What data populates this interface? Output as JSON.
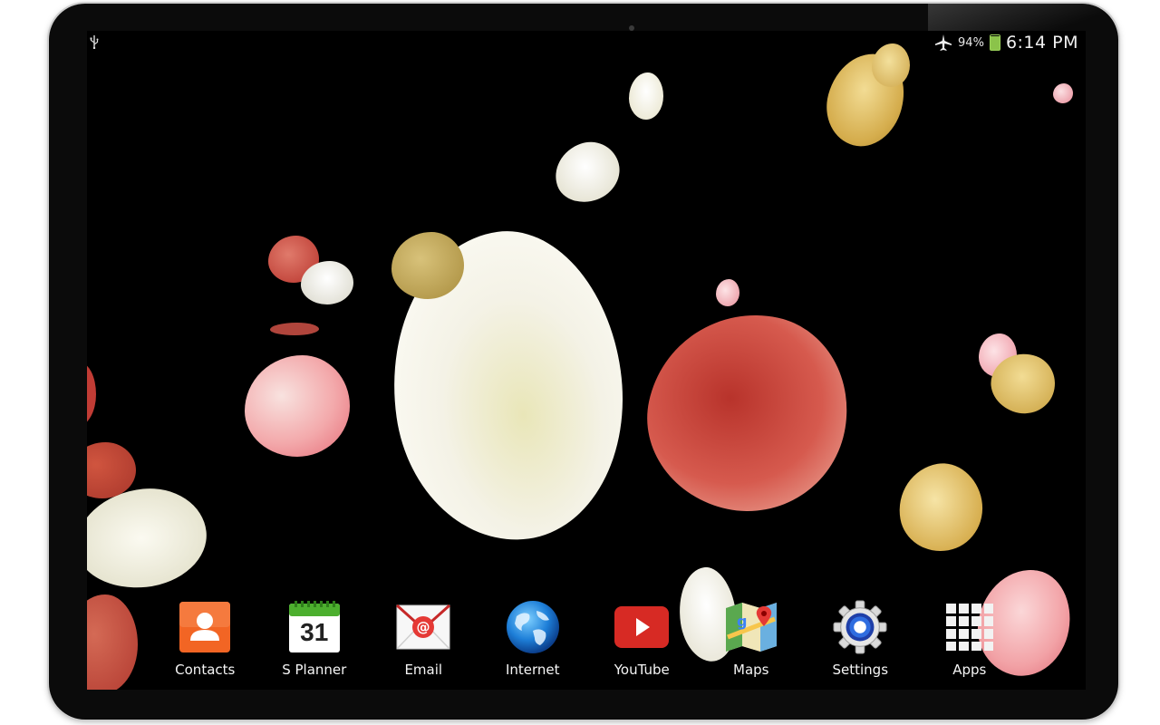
{
  "status_bar": {
    "battery_percent": "94%",
    "time": "6:14 PM",
    "icons": [
      "usb-icon",
      "airplane-mode-icon",
      "battery-icon"
    ]
  },
  "dock": {
    "apps": [
      {
        "label": "Contacts",
        "icon": "contacts-icon"
      },
      {
        "label": "S Planner",
        "icon": "calendar-icon",
        "date": "31"
      },
      {
        "label": "Email",
        "icon": "email-icon"
      },
      {
        "label": "Internet",
        "icon": "globe-icon"
      },
      {
        "label": "YouTube",
        "icon": "youtube-icon"
      },
      {
        "label": "Maps",
        "icon": "maps-icon"
      },
      {
        "label": "Settings",
        "icon": "gear-icon"
      },
      {
        "label": "Apps",
        "icon": "app-grid-icon"
      }
    ]
  },
  "wallpaper": {
    "theme": "falling rose petals on black",
    "colors": {
      "background": "#000000",
      "white_petal": "#f2efdf",
      "red_petal": "#c9463f",
      "pink_petal": "#f0a9b0",
      "gold_petal": "#d9b75a"
    }
  }
}
